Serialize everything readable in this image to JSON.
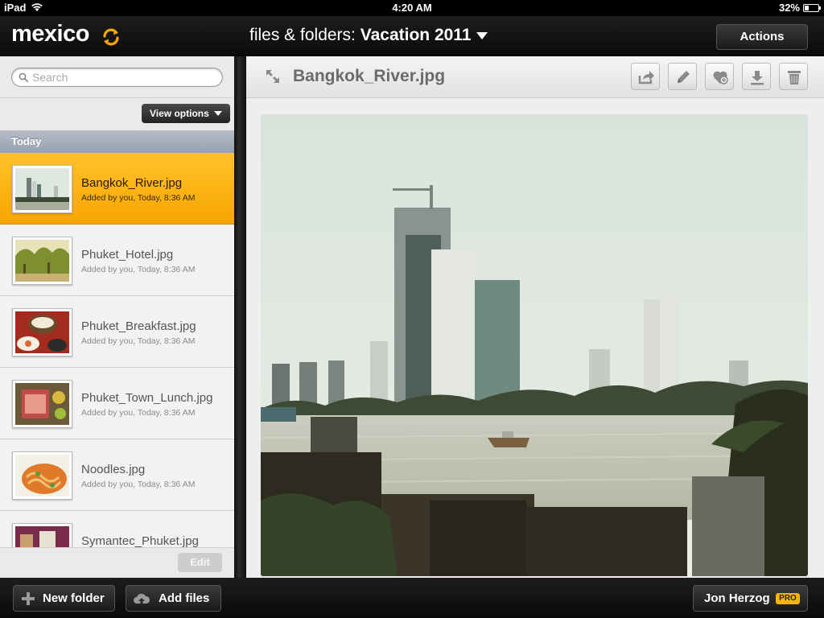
{
  "status_bar": {
    "carrier": "iPad",
    "time": "4:20 AM",
    "battery_percent": "32%",
    "battery_level": 0.32
  },
  "header": {
    "app_name": "mexico",
    "breadcrumb_prefix": "files & folders: ",
    "current_folder": "Vacation 2011",
    "actions_label": "Actions"
  },
  "sidebar": {
    "search_placeholder": "Search",
    "view_options_label": "View options",
    "section_title": "Today",
    "edit_label": "Edit",
    "files": [
      {
        "name": "Bangkok_River.jpg",
        "meta": "Added by you, Today, 8:36 AM",
        "selected": true
      },
      {
        "name": "Phuket_Hotel.jpg",
        "meta": "Added by you, Today, 8:36 AM",
        "selected": false
      },
      {
        "name": "Phuket_Breakfast.jpg",
        "meta": "Added by you, Today, 8:36 AM",
        "selected": false
      },
      {
        "name": "Phuket_Town_Lunch.jpg",
        "meta": "Added by you, Today, 8:36 AM",
        "selected": false
      },
      {
        "name": "Noodles.jpg",
        "meta": "Added by you, Today, 8:36 AM",
        "selected": false
      },
      {
        "name": "Symantec_Phuket.jpg",
        "meta": "",
        "selected": false
      }
    ]
  },
  "main": {
    "title": "Bangkok_River.jpg",
    "toolbar_icons": [
      "share-icon",
      "edit-pencil-icon",
      "favorite-heart-icon",
      "download-icon",
      "trash-icon"
    ]
  },
  "footer": {
    "new_folder_label": "New folder",
    "add_files_label": "Add files",
    "user_name": "Jon Herzog",
    "badge": "PRO"
  },
  "colors": {
    "accent": "#f7a600",
    "bar_dark": "#111111",
    "sidebar_bg": "#eaeaea"
  }
}
